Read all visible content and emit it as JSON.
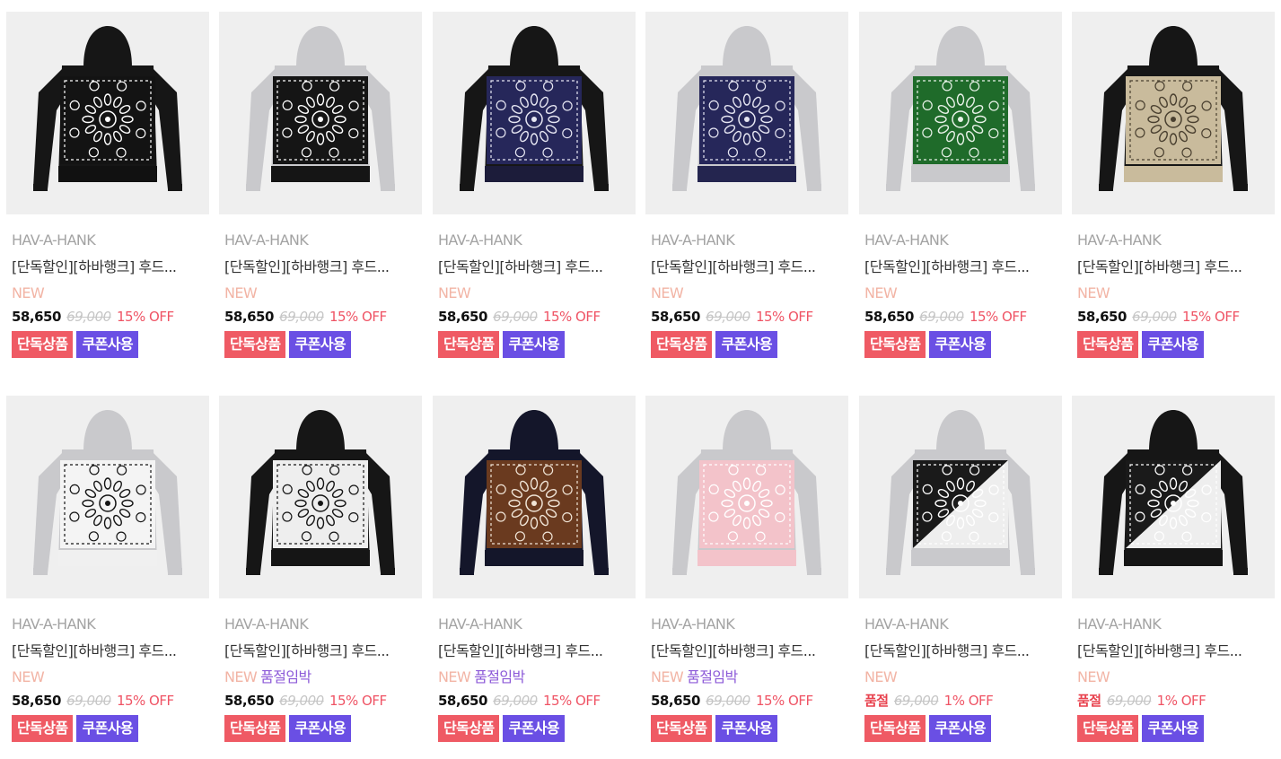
{
  "products": [
    {
      "brand": "HAV-A-HANK",
      "name": "[단독할인][하바행크] 후드...",
      "tags": [
        "NEW"
      ],
      "price": "58,650",
      "original_price": "69,000",
      "discount": "15% OFF",
      "badges": [
        "단독상품",
        "쿠폰사용"
      ],
      "colors": {
        "body": "#161616",
        "sleeve": "#161616",
        "panel": "#131313",
        "pattern": "#ffffff",
        "rib": "#111111"
      }
    },
    {
      "brand": "HAV-A-HANK",
      "name": "[단독할인][하바행크] 후드...",
      "tags": [
        "NEW"
      ],
      "price": "58,650",
      "original_price": "69,000",
      "discount": "15% OFF",
      "badges": [
        "단독상품",
        "쿠폰사용"
      ],
      "colors": {
        "body": "#c9c9cc",
        "sleeve": "#c9c9cc",
        "panel": "#151515",
        "pattern": "#ffffff",
        "rib": "#151515"
      }
    },
    {
      "brand": "HAV-A-HANK",
      "name": "[단독할인][하바행크] 후드...",
      "tags": [
        "NEW"
      ],
      "price": "58,650",
      "original_price": "69,000",
      "discount": "15% OFF",
      "badges": [
        "단독상품",
        "쿠폰사용"
      ],
      "colors": {
        "body": "#161616",
        "sleeve": "#161616",
        "panel": "#26275a",
        "pattern": "#e6e6f2",
        "rib": "#1c1c3a"
      }
    },
    {
      "brand": "HAV-A-HANK",
      "name": "[단독할인][하바행크] 후드...",
      "tags": [
        "NEW"
      ],
      "price": "58,650",
      "original_price": "69,000",
      "discount": "15% OFF",
      "badges": [
        "단독상품",
        "쿠폰사용"
      ],
      "colors": {
        "body": "#c9c9cc",
        "sleeve": "#c9c9cc",
        "panel": "#26275a",
        "pattern": "#e6e6f2",
        "rib": "#24254f"
      }
    },
    {
      "brand": "HAV-A-HANK",
      "name": "[단독할인][하바행크] 후드...",
      "tags": [
        "NEW"
      ],
      "price": "58,650",
      "original_price": "69,000",
      "discount": "15% OFF",
      "badges": [
        "단독상품",
        "쿠폰사용"
      ],
      "colors": {
        "body": "#c9c9cc",
        "sleeve": "#c9c9cc",
        "panel": "#1f6b2a",
        "pattern": "#e9f2e9",
        "rib": "#c9c9cc"
      }
    },
    {
      "brand": "HAV-A-HANK",
      "name": "[단독할인][하바행크] 후드...",
      "tags": [
        "NEW"
      ],
      "price": "58,650",
      "original_price": "69,000",
      "discount": "15% OFF",
      "badges": [
        "단독상품",
        "쿠폰사용"
      ],
      "colors": {
        "body": "#161616",
        "sleeve": "#161616",
        "panel": "#c9bb9c",
        "pattern": "#4a4030",
        "rib": "#c9bb9c"
      }
    },
    {
      "brand": "HAV-A-HANK",
      "name": "[단독할인][하바행크] 후드...",
      "tags": [
        "NEW"
      ],
      "price": "58,650",
      "original_price": "69,000",
      "discount": "15% OFF",
      "badges": [
        "단독상품",
        "쿠폰사용"
      ],
      "colors": {
        "body": "#c9c9cc",
        "sleeve": "#c9c9cc",
        "panel": "#f4f4f4",
        "pattern": "#151515",
        "rib": "#f0f0f0"
      }
    },
    {
      "brand": "HAV-A-HANK",
      "name": "[단독할인][하바행크] 후드...",
      "tags": [
        "NEW",
        "품절임박"
      ],
      "price": "58,650",
      "original_price": "69,000",
      "discount": "15% OFF",
      "badges": [
        "단독상품",
        "쿠폰사용"
      ],
      "colors": {
        "body": "#161616",
        "sleeve": "#161616",
        "panel": "#eeeeee",
        "pattern": "#151515",
        "rib": "#151515"
      }
    },
    {
      "brand": "HAV-A-HANK",
      "name": "[단독할인][하바행크] 후드...",
      "tags": [
        "NEW",
        "품절임박"
      ],
      "price": "58,650",
      "original_price": "69,000",
      "discount": "15% OFF",
      "badges": [
        "단독상품",
        "쿠폰사용"
      ],
      "colors": {
        "body": "#14162a",
        "sleeve": "#14162a",
        "panel": "#6a3a1f",
        "pattern": "#f0e4d6",
        "rib": "#14162a"
      }
    },
    {
      "brand": "HAV-A-HANK",
      "name": "[단독할인][하바행크] 후드...",
      "tags": [
        "NEW",
        "품절임박"
      ],
      "price": "58,650",
      "original_price": "69,000",
      "discount": "15% OFF",
      "badges": [
        "단독상품",
        "쿠폰사용"
      ],
      "colors": {
        "body": "#c9c9cc",
        "sleeve": "#c9c9cc",
        "panel": "#f3c3ca",
        "pattern": "#ffffff",
        "rib": "#f3c3ca"
      }
    },
    {
      "brand": "HAV-A-HANK",
      "name": "[단독할인][하바행크] 후드...",
      "tags": [
        "NEW"
      ],
      "price": "품절",
      "price_soldout": true,
      "original_price": "69,000",
      "discount": "1% OFF",
      "badges": [
        "단독상품",
        "쿠폰사용"
      ],
      "colors": {
        "body": "#c9c9cc",
        "sleeve": "#c9c9cc",
        "panel": "#1a1a1a",
        "panel2": "#eeeeee",
        "pattern": "#ffffff",
        "rib": "#c9c9cc"
      }
    },
    {
      "brand": "HAV-A-HANK",
      "name": "[단독할인][하바행크] 후드...",
      "tags": [
        "NEW"
      ],
      "price": "품절",
      "price_soldout": true,
      "original_price": "69,000",
      "discount": "1% OFF",
      "badges": [
        "단독상품",
        "쿠폰사용"
      ],
      "colors": {
        "body": "#161616",
        "sleeve": "#161616",
        "panel": "#1a1a1a",
        "panel2": "#eeeeee",
        "pattern": "#ffffff",
        "rib": "#151515"
      }
    }
  ]
}
